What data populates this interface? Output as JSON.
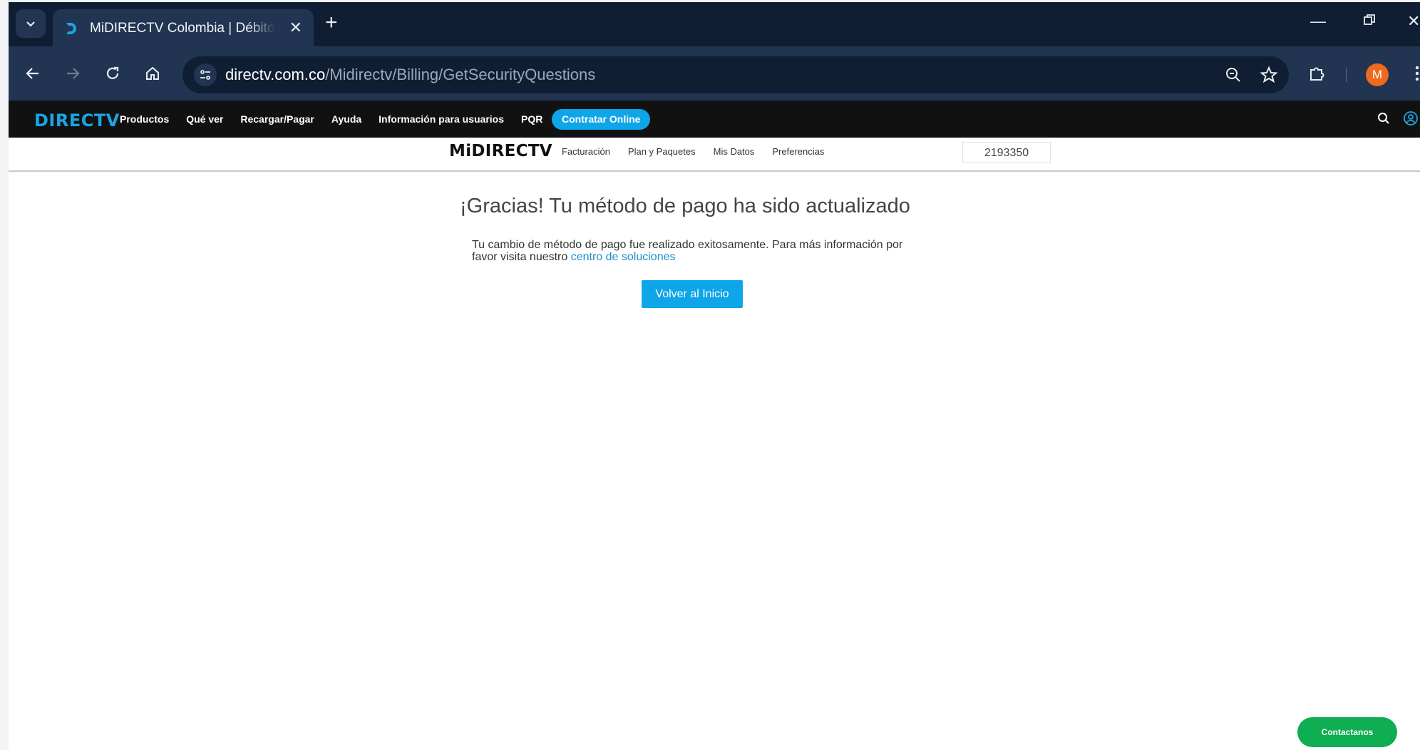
{
  "browser": {
    "tab_title": "MiDIRECTV Colombia | Débito",
    "url_host": "directv.com.co",
    "url_path": "/Midirectv/Billing/GetSecurityQuestions",
    "profile_initial": "M"
  },
  "site_nav": {
    "logo": "DIRECTV",
    "links": [
      "Productos",
      "Qué ver",
      "Recargar/Pagar",
      "Ayuda",
      "Información para usuarios",
      "PQR"
    ],
    "cta": "Contratar Online"
  },
  "sub_nav": {
    "logo": "MiDIRECTV",
    "links": [
      "Facturación",
      "Plan y Paquetes",
      "Mis Datos",
      "Preferencias"
    ],
    "account_number": "2193350"
  },
  "content": {
    "title": "¡Gracias! Tu método de pago ha sido actualizado",
    "message_prefix": "Tu cambio de método de pago fue realizado exitosamente. Para más información por favor visita nuestro ",
    "message_link": "centro de soluciones",
    "primary_button": "Volver al Inicio"
  },
  "contact_button": "Contactanos",
  "colors": {
    "accent": "#0ea5e9",
    "contact": "#0fae52",
    "chrome_dark": "#0f1e33",
    "chrome_toolbar": "#213552"
  }
}
